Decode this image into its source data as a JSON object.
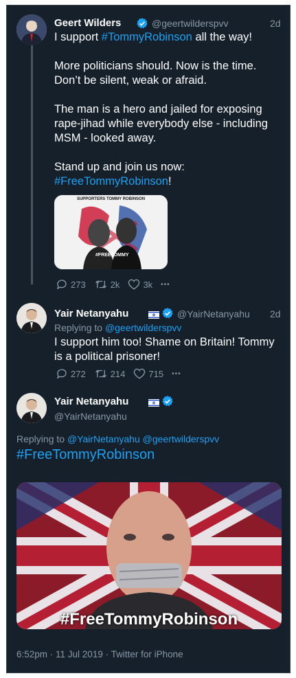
{
  "tweet1": {
    "name": "Geert Wilders",
    "handle": "@geertwilderspvv",
    "time": "2d",
    "line1_pre": "I support ",
    "line1_tag": "#TommyRobinson",
    "line1_post": " all the way!",
    "para2a": "More politicians should. Now is the time.",
    "para2b": "Don’t be silent, weak or afraid.",
    "para3a": "The man is a hero and jailed for exposing",
    "para3b": "rape-jihad while everybody else - including",
    "para3c": "MSM - looked away.",
    "para4a": "Stand up and join us now:",
    "para4_tag": "#FreeTommyRobinson",
    "para4_post": "!",
    "image_caption_top": "SUPPORTERS   TOMMY ROBINSON",
    "image_caption": "#FREETOMMY",
    "replies": "273",
    "retweets": "2k",
    "likes": "3k",
    "more": "•••"
  },
  "tweet2": {
    "name": "Yair Netanyahu",
    "handle": "@YairNetanyahu",
    "time": "2d",
    "replying_label": "Replying to ",
    "replying_to": "@geertwilderspvv",
    "line1": "I support him too! Shame on Britain! Tommy",
    "line2": "is a political prisoner!",
    "replies": "272",
    "retweets": "214",
    "likes": "715",
    "more": "•••"
  },
  "tweet3": {
    "name": "Yair Netanyahu",
    "handle": "@YairNetanyahu",
    "replying_label": "Replying to ",
    "replying_to_1": "@YairNetanyahu",
    "replying_to_2": "@geertwilderspvv",
    "hashtag": "#FreeTommyRobinson",
    "image_caption": "#FreeTommyRobinson",
    "footer": "6:52pm · 11 Jul 2019 · Twitter for iPhone"
  },
  "colors": {
    "background": "#15202b",
    "accent": "#1da1f2",
    "muted": "#8899a6"
  }
}
